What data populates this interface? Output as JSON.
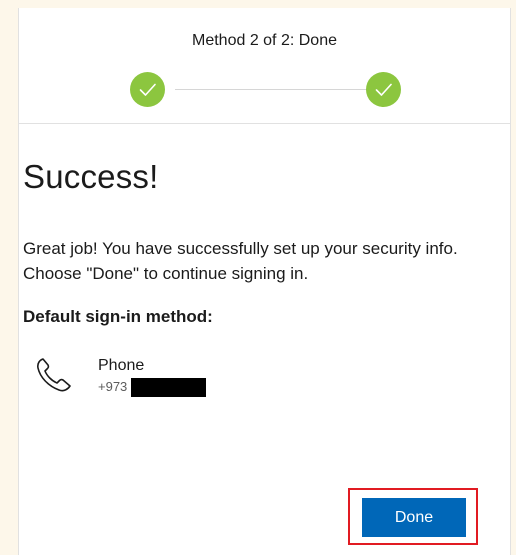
{
  "header": {
    "step_title": "Method 2 of 2: Done",
    "steps": [
      {
        "state": "complete",
        "icon": "checkmark-icon"
      },
      {
        "state": "complete",
        "icon": "checkmark-icon"
      }
    ]
  },
  "content": {
    "title": "Success!",
    "message": "Great job! You have successfully set up your security info. Choose \"Done\" to continue signing in.",
    "default_method_label": "Default sign-in method:",
    "method": {
      "icon": "phone-icon",
      "name": "Phone",
      "number_prefix": "+973"
    }
  },
  "footer": {
    "done_label": "Done"
  },
  "colors": {
    "page_background": "#fdf7ea",
    "check_green": "#8cc63f",
    "primary_blue": "#0067b8",
    "highlight_red": "#e11b22"
  }
}
